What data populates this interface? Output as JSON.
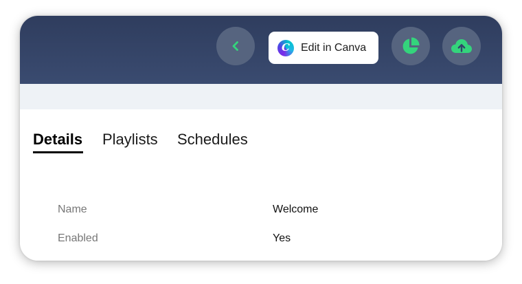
{
  "header": {
    "back_icon": "chevron-left-icon",
    "canva_button_label": "Edit in Canva",
    "canva_logo_letter": "C",
    "stats_icon": "pie-chart-icon",
    "upload_icon": "cloud-upload-icon",
    "accent_color": "#34d47c",
    "bar_color": "#33426a"
  },
  "tabs": [
    {
      "label": "Details",
      "active": true
    },
    {
      "label": "Playlists",
      "active": false
    },
    {
      "label": "Schedules",
      "active": false
    }
  ],
  "details": {
    "rows": [
      {
        "label": "Name",
        "value": "Welcome"
      },
      {
        "label": "Enabled",
        "value": "Yes"
      }
    ]
  }
}
